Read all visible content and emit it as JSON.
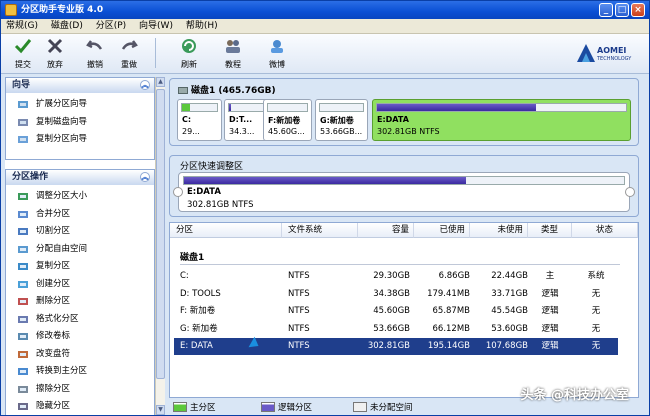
{
  "app": {
    "title": "分区助手专业版 4.0"
  },
  "menu": [
    "常规(G)",
    "磁盘(D)",
    "分区(P)",
    "向导(W)",
    "帮助(H)"
  ],
  "toolbar": {
    "items": [
      "提交",
      "放弃",
      "撤销",
      "重做",
      "刷新",
      "教程",
      "微博"
    ],
    "brand": "AOMEI",
    "brand_sub": "TECHNOLOGY"
  },
  "wizard": {
    "title": "向导",
    "items": [
      "扩展分区向导",
      "复制磁盘向导",
      "复制分区向导"
    ]
  },
  "ops": {
    "title": "分区操作",
    "items": [
      "调整分区大小",
      "合并分区",
      "切割分区",
      "分配自由空间",
      "复制分区",
      "创建分区",
      "删除分区",
      "格式化分区",
      "修改卷标",
      "改变盘符",
      "转换到主分区",
      "擦除分区",
      "隐藏分区"
    ]
  },
  "disk": {
    "title": "磁盘1  (465.76GB)",
    "parts": [
      {
        "name": "C:",
        "size": "29...",
        "fill": 0.23
      },
      {
        "name": "D:T...",
        "size": "34.3...",
        "fill": 0.05
      },
      {
        "name": "F:新加卷",
        "size": "45.60G...",
        "fill": 0.01
      },
      {
        "name": "G:新加卷",
        "size": "53.66GB...",
        "fill": 0.01
      },
      {
        "name": "E:DATA",
        "size": "302.81GB NTFS",
        "fill": 0.64
      }
    ]
  },
  "resize": {
    "title": "分区快速调整区",
    "name": "E:DATA",
    "size": "302.81GB NTFS",
    "fill": 0.64
  },
  "table": {
    "headers": [
      "分区",
      "文件系统",
      "容量",
      "已使用",
      "未使用",
      "类型",
      "状态"
    ],
    "group": "磁盘1",
    "rows": [
      {
        "part": "C:",
        "fs": "NTFS",
        "cap": "29.30GB",
        "used": "6.86GB",
        "free": "22.44GB",
        "type": "主",
        "status": "系统"
      },
      {
        "part": "D: TOOLS",
        "fs": "NTFS",
        "cap": "34.38GB",
        "used": "179.41MB",
        "free": "33.71GB",
        "type": "逻辑",
        "status": "无"
      },
      {
        "part": "F: 新加卷",
        "fs": "NTFS",
        "cap": "45.60GB",
        "used": "65.87MB",
        "free": "45.54GB",
        "type": "逻辑",
        "status": "无"
      },
      {
        "part": "G: 新加卷",
        "fs": "NTFS",
        "cap": "53.66GB",
        "used": "66.12MB",
        "free": "53.60GB",
        "type": "逻辑",
        "status": "无"
      },
      {
        "part": "E: DATA",
        "fs": "NTFS",
        "cap": "302.81GB",
        "used": "195.14GB",
        "free": "107.68GB",
        "type": "逻辑",
        "status": "无"
      }
    ]
  },
  "legend": [
    "主分区",
    "逻辑分区",
    "未分配空间"
  ],
  "watermark": "头条 @科技办公室",
  "colors": {
    "primary": "#5cc83c",
    "logical": "#3a2aa0",
    "unallocated": "#f0f0f0",
    "selected_row": "#1f3e8c"
  }
}
